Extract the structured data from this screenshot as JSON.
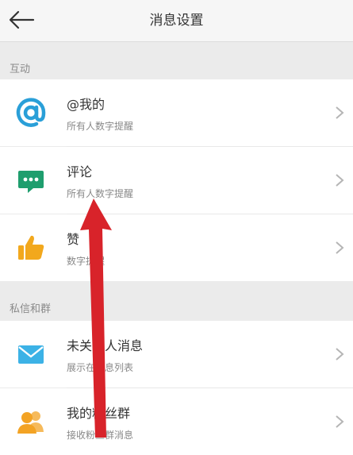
{
  "header": {
    "title": "消息设置"
  },
  "sections": [
    {
      "label": "互动"
    },
    {
      "label": "私信和群"
    }
  ],
  "items": [
    {
      "label": "@我的",
      "sub": "所有人数字提醒",
      "icon": "at-icon"
    },
    {
      "label": "评论",
      "sub": "所有人数字提醒",
      "icon": "comment-icon"
    },
    {
      "label": "赞",
      "sub": "数字提醒",
      "icon": "thumbs-up-icon"
    },
    {
      "label": "未关注人消息",
      "sub": "展示在消息列表",
      "icon": "mail-icon"
    },
    {
      "label": "我的粉丝群",
      "sub": "接收粉丝群消息",
      "icon": "group-icon"
    }
  ],
  "colors": {
    "at": "#2a9fd8",
    "comment": "#1f9e6e",
    "like": "#f2a81d",
    "mail": "#3cb2e6",
    "group": "#f3a324",
    "arrow": "#d8232a"
  }
}
